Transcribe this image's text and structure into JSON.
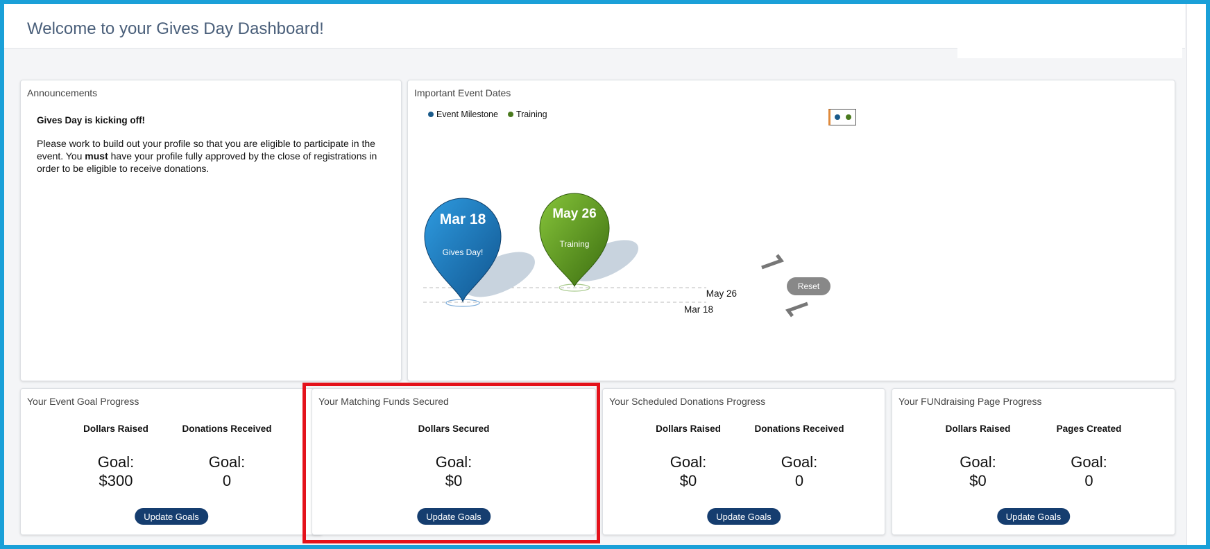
{
  "page": {
    "title": "Welcome to your Gives Day Dashboard!"
  },
  "announcements": {
    "title": "Announcements",
    "heading": "Gives Day is kicking off!",
    "body_part1": "Please work to build out your profile so that you are eligible to participate in the event. You ",
    "body_bold": "must",
    "body_part2": " have your profile fully approved by the close of registrations in order to be eligible to receive donations."
  },
  "event_dates": {
    "title": "Important Event Dates",
    "legend": [
      {
        "label": "Event Milestone",
        "color": "#1a5a8a"
      },
      {
        "label": "Training",
        "color": "#4a7a1e"
      }
    ],
    "pins": [
      {
        "date": "Mar 18",
        "label": "Gives Day!",
        "color": "#1c7fc4"
      },
      {
        "date": "May 26",
        "label": "Training",
        "color": "#5a9b1c"
      }
    ],
    "axis_labels": [
      "May 26",
      "Mar 18"
    ],
    "reset_label": "Reset"
  },
  "cards": [
    {
      "title": "Your Event Goal Progress",
      "metrics": [
        {
          "label": "Dollars Raised",
          "goal_label": "Goal:",
          "goal_value": "$300"
        },
        {
          "label": "Donations Received",
          "goal_label": "Goal:",
          "goal_value": "0"
        }
      ],
      "button": "Update Goals"
    },
    {
      "title": "Your Matching Funds Secured",
      "metrics": [
        {
          "label": "Dollars Secured",
          "goal_label": "Goal:",
          "goal_value": "$0"
        }
      ],
      "button": "Update Goals"
    },
    {
      "title": "Your Scheduled Donations Progress",
      "metrics": [
        {
          "label": "Dollars Raised",
          "goal_label": "Goal:",
          "goal_value": "$0"
        },
        {
          "label": "Donations Received",
          "goal_label": "Goal:",
          "goal_value": "0"
        }
      ],
      "button": "Update Goals"
    },
    {
      "title": "Your FUNdraising Page Progress",
      "metrics": [
        {
          "label": "Dollars Raised",
          "goal_label": "Goal:",
          "goal_value": "$0"
        },
        {
          "label": "Pages Created",
          "goal_label": "Goal:",
          "goal_value": "0"
        }
      ],
      "button": "Update Goals"
    }
  ],
  "colors": {
    "accent": "#1aa0d8",
    "button": "#153d6f",
    "highlight": "#e4121b"
  }
}
